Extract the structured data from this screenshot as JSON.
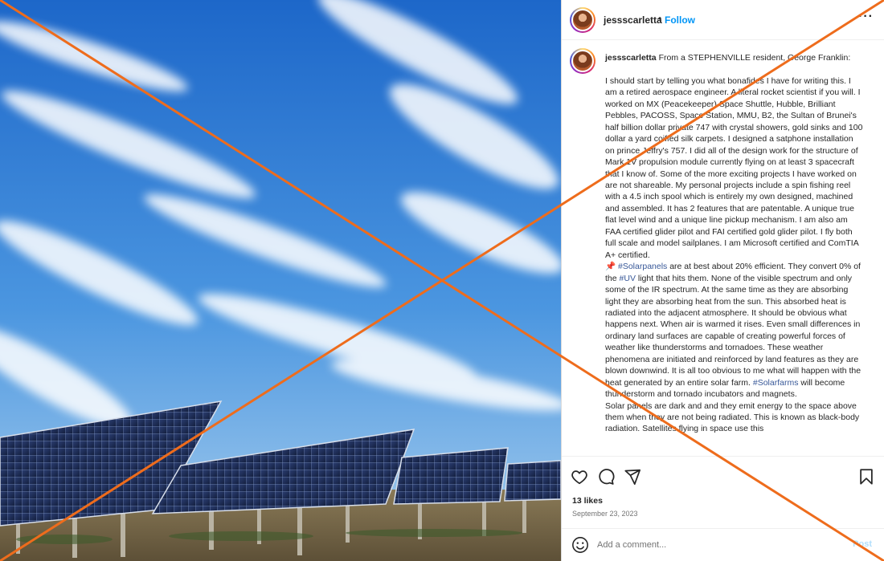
{
  "post": {
    "username": "jessscarletta",
    "separator": "•",
    "follow_label": "Follow",
    "more_label": "···",
    "caption": {
      "username": "jessscarletta",
      "intro": "From a STEPHENVILLE resident, George Franklin:",
      "paragraph1": "I should start by telling you what bonafides I have for writing this. I am a retired aerospace engineer. A literal rocket scientist if you will. I worked on MX (Peacekeeper) Space Shuttle, Hubble, Brilliant Pebbles, PACOSS, Space Station, MMU, B2, the Sultan of Brunei's half billion dollar private 747 with crystal showers, gold sinks and 100 dollar a yard coiffed silk carpets. I designed a satphone installation on prince Jeffry's 757. I did all of the design work for the structure of Mark 1V propulsion module currently flying on at least 3 spacecraft that I know of. Some of the more exciting projects I have worked on are not shareable. My personal projects include a spin fishing reel with a 4.5 inch spool which is entirely my own designed, machined and assembled. It has 2 features that are patentable. A unique true flat level wind and a unique line pickup mechanism. I am also am FAA certified glider pilot and FAI certified gold glider pilot. I fly both full scale and model sailplanes. I am Microsoft certified and ComTIA A+ certified.",
      "pin_emoji": "📌",
      "tag_solarpanels": "#Solarpanels",
      "p2a": "are at best about 20% efficient. They convert 0% of the",
      "tag_uv": "#UV",
      "p2b": "light that hits them. None of the visible spectrum and only some of the IR spectrum. At the same time as they are absorbing light they are absorbing heat from the sun. This absorbed heat is radiated into the adjacent atmosphere. It should be obvious what happens next. When air is warmed it rises. Even small differences in ordinary land surfaces are capable of creating powerful forces of weather like thunderstorms and tornadoes. These weather phenomena are initiated and reinforced by land features as they are blown downwind. It is all too obvious to me what will happen with the heat generated by an entire solar farm.",
      "tag_solarfarms": "#Solarfarms",
      "p2c": "will become thunderstorm and tornado incubators and magnets.",
      "paragraph3": "Solar panels are dark and and they emit energy to the space above them when they are not being radiated. This is known as black-body radiation. Satellites flying in space use this"
    },
    "likes": "13 likes",
    "date": "September 23, 2023",
    "comment_placeholder": "Add a comment...",
    "post_label": "Post"
  },
  "icons": {
    "like": "heart-icon",
    "comment": "comment-icon",
    "share": "share-icon",
    "save": "bookmark-icon",
    "emoji": "emoji-icon"
  },
  "colors": {
    "overlay_x": "#ee6c1c",
    "link": "#0095f6",
    "hashtag": "#385898",
    "sky_top": "#1f6fd0",
    "sky_bottom": "#8fc2ef",
    "panel_dark": "#1b2a52"
  }
}
